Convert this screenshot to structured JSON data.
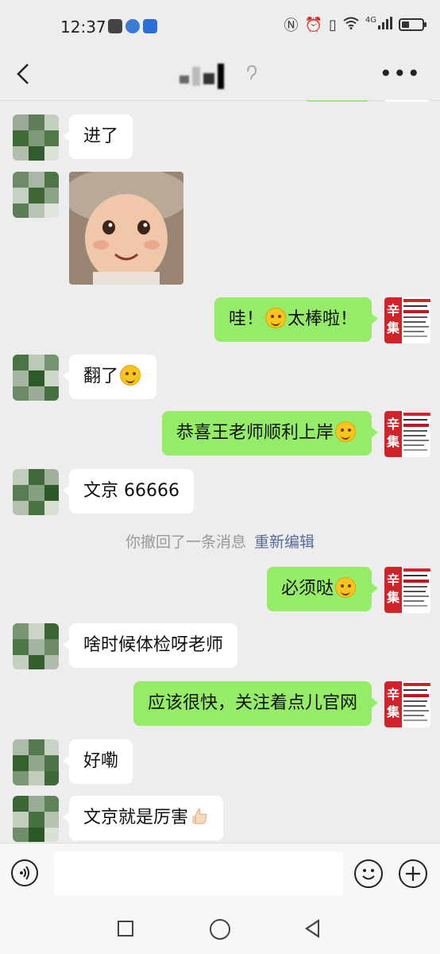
{
  "status_bar": {
    "time": "12:37",
    "network": "4G",
    "icons": [
      "nfc-icon",
      "alarm-icon",
      "vibrate-icon",
      "wifi-icon",
      "signal-icon",
      "battery-icon"
    ]
  },
  "header": {
    "back_icon": "chevron-left-icon",
    "title_masked": true,
    "ear_icon": "earpiece-icon",
    "more_label": "•••"
  },
  "messages": [
    {
      "side": "left",
      "type": "text",
      "text": "进了"
    },
    {
      "side": "left",
      "type": "image",
      "description_icon": "baby-photo"
    },
    {
      "side": "right",
      "type": "text",
      "text_before": "哇！",
      "emoji": "kiss-emoji",
      "text_after": "太棒啦！"
    },
    {
      "side": "left",
      "type": "text",
      "text": "翻了",
      "emoji": "smirk-emoji"
    },
    {
      "side": "right",
      "type": "text",
      "text": "恭喜王老师顺利上岸",
      "emoji": "grin-emoji"
    },
    {
      "side": "left",
      "type": "text",
      "text": "文京 66666"
    },
    {
      "side": "right",
      "type": "text",
      "text": "必须哒",
      "emoji": "wink-emoji"
    },
    {
      "side": "left",
      "type": "text",
      "text": "啥时候体检呀老师"
    },
    {
      "side": "right",
      "type": "text",
      "text": "应该很快，关注着点儿官网"
    },
    {
      "side": "left",
      "type": "text",
      "text": "好嘞"
    },
    {
      "side": "left",
      "type": "text",
      "text": "文京就是厉害",
      "emoji": "thumbs-up-emoji"
    }
  ],
  "recall_notice": {
    "text": "你撤回了一条消息",
    "link": "重新编辑"
  },
  "self_avatar": {
    "big_chars_top": "辛",
    "big_chars_bottom": "集"
  },
  "input_bar": {
    "voice_icon": "voice-icon",
    "input_value": "",
    "emoji_icon": "emoji-icon",
    "plus_icon": "plus-icon"
  },
  "system_nav": {
    "recent_icon": "square-icon",
    "home_icon": "circle-icon",
    "back_icon": "triangle-back-icon"
  },
  "colors": {
    "background": "#ededed",
    "bubble_self": "#95ec69",
    "bubble_other": "#ffffff",
    "link": "#576b95"
  }
}
